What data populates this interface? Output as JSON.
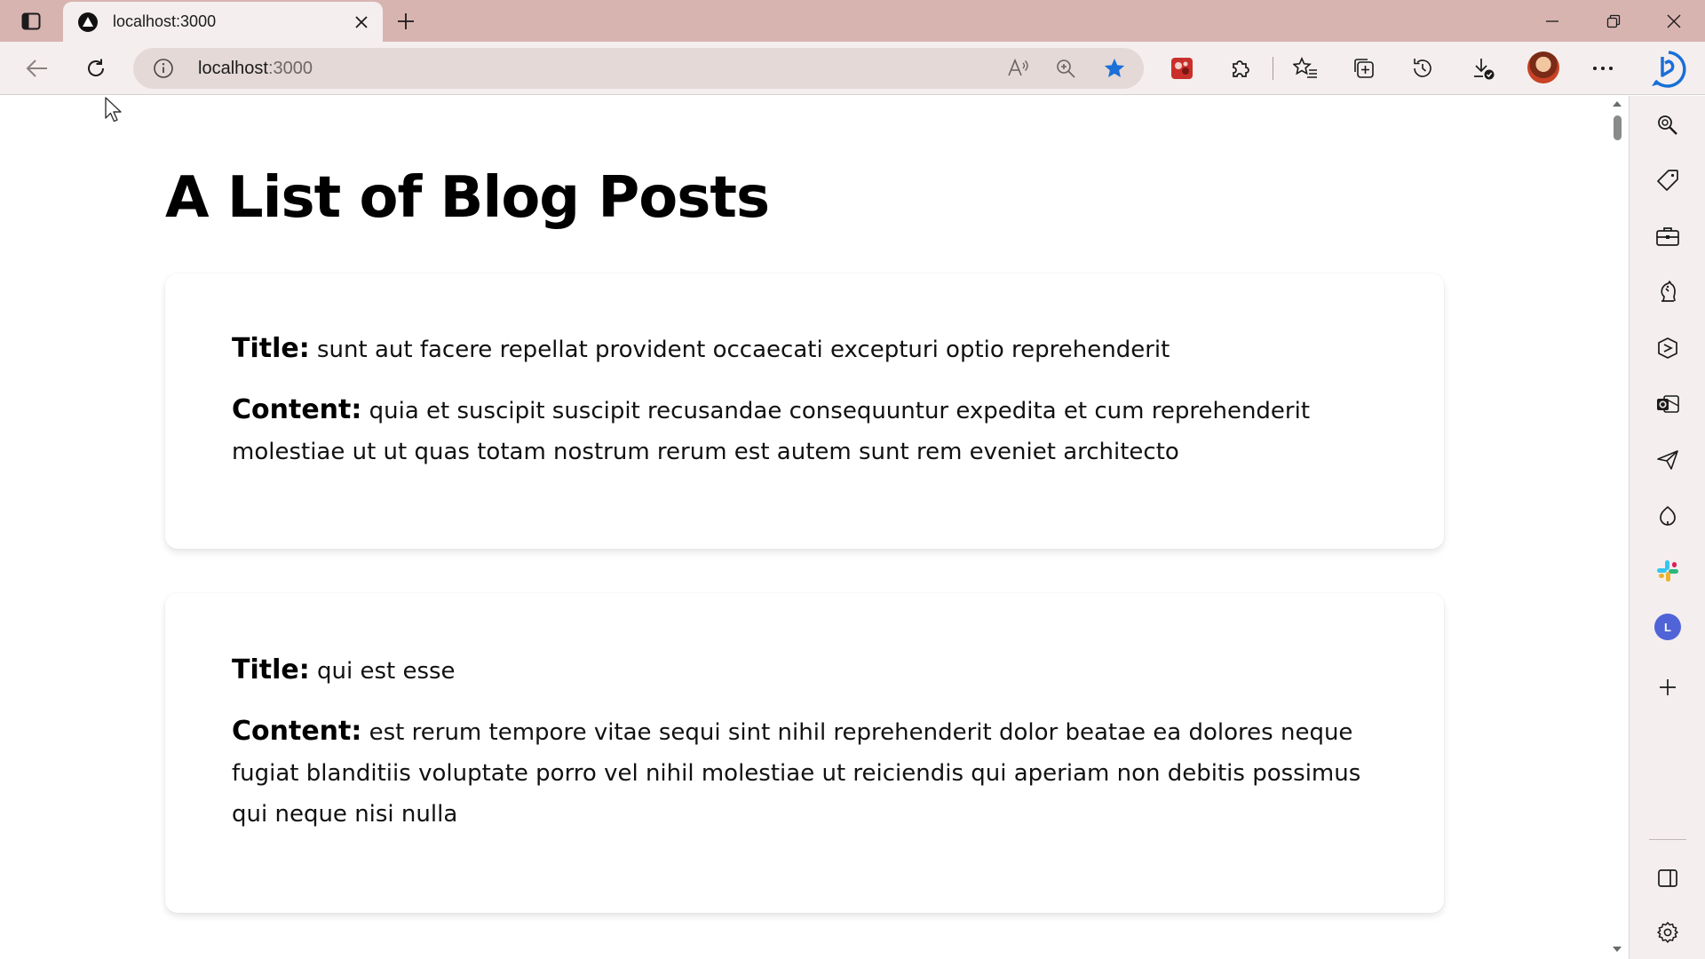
{
  "browser": {
    "tab": {
      "title": "localhost:3000"
    },
    "address": {
      "host": "localhost",
      "port": ":3000"
    }
  },
  "page": {
    "heading": "A List of Blog Posts",
    "title_label": "Title:",
    "content_label": "Content:",
    "posts": [
      {
        "title": "sunt aut facere repellat provident occaecati excepturi optio reprehenderit",
        "content_lines": [
          "quia et suscipit suscipit recusandae consequuntur expedita et cum reprehenderit",
          "molestiae ut ut quas totam nostrum rerum est autem sunt rem eveniet architecto"
        ]
      },
      {
        "title": "qui est esse",
        "content_lines": [
          "est rerum tempore vitae sequi sint nihil reprehenderit dolor beatae ea dolores neque",
          "fugiat blanditiis voluptate porro vel nihil molestiae ut reiciendis qui aperiam non debitis possimus",
          "qui neque nisi nulla"
        ]
      }
    ]
  },
  "sidebar": {
    "profile_badge": "L"
  },
  "colors": {
    "titlebar": "#d8b4b0",
    "toolbar": "#f4efee",
    "favorite_star": "#1a6fd8",
    "accent_blue": "#1a6fd8"
  }
}
